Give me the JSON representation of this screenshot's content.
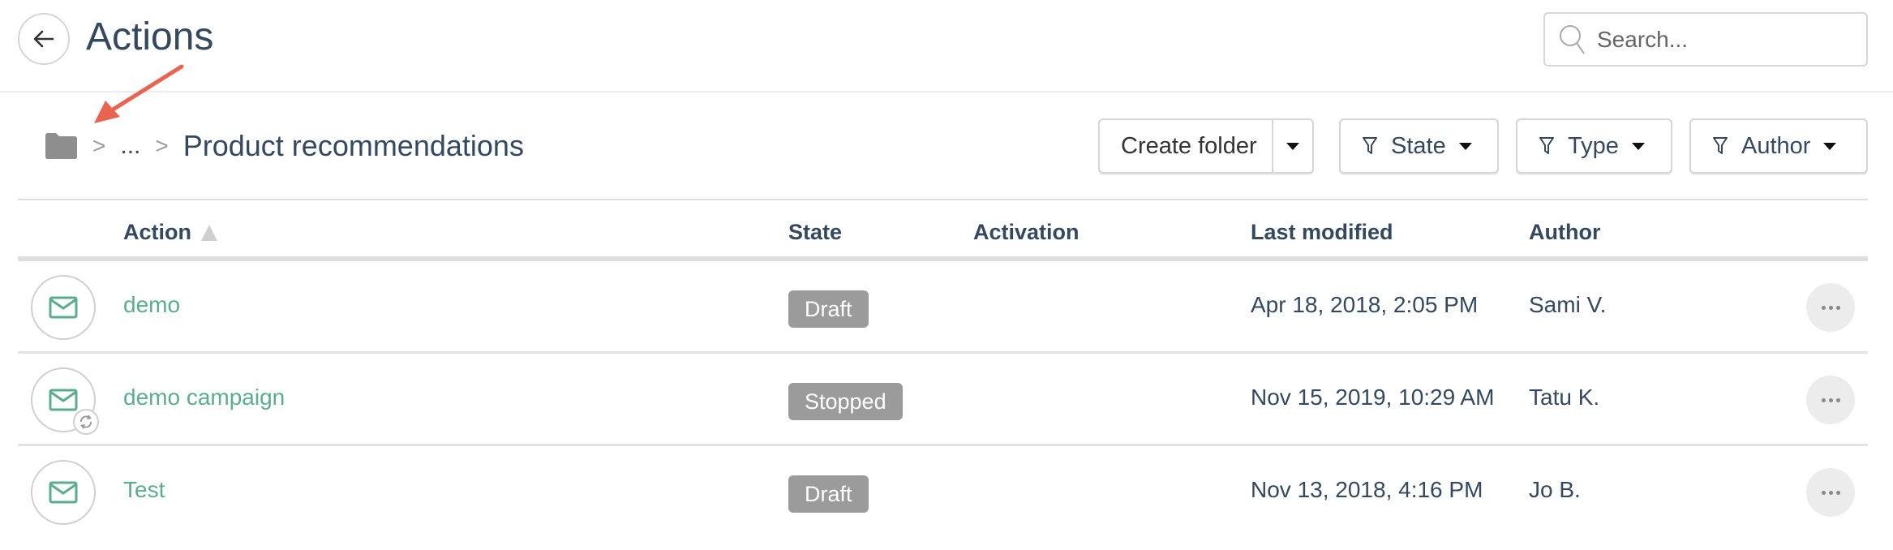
{
  "header": {
    "title": "Actions",
    "back_icon": "arrow-left-icon",
    "search": {
      "placeholder": "Search...",
      "value": "",
      "icon": "search-icon"
    }
  },
  "breadcrumb": {
    "root_icon": "folder-icon",
    "separator": ">",
    "ellipsis": "...",
    "current": "Product recommendations"
  },
  "toolbar": {
    "create_folder": "Create folder",
    "filters": [
      {
        "label": "State",
        "icon": "filter-icon"
      },
      {
        "label": "Type",
        "icon": "filter-icon"
      },
      {
        "label": "Author",
        "icon": "filter-icon"
      }
    ]
  },
  "table": {
    "columns": [
      "Action",
      "State",
      "Activation",
      "Last modified",
      "Author"
    ],
    "sort": {
      "column": "Action",
      "direction": "ascending"
    },
    "rows": [
      {
        "icon": "envelope-icon",
        "recurring": false,
        "name": "demo",
        "state": "Draft",
        "activation": "",
        "last_modified": "Apr 18, 2018, 2:05 PM",
        "author": "Sami V."
      },
      {
        "icon": "envelope-icon",
        "recurring": true,
        "name": "demo campaign",
        "state": "Stopped",
        "activation": "",
        "last_modified": "Nov 15, 2019, 10:29 AM",
        "author": "Tatu K."
      },
      {
        "icon": "envelope-icon",
        "recurring": false,
        "name": "Test",
        "state": "Draft",
        "activation": "",
        "last_modified": "Nov 13, 2018, 4:16 PM",
        "author": "Jo B."
      }
    ]
  },
  "colors": {
    "accent_green": "#5aad8f",
    "text_dark": "#34495e",
    "badge_gray": "#9b9b9b",
    "annotation_arrow": "#e8644f"
  }
}
